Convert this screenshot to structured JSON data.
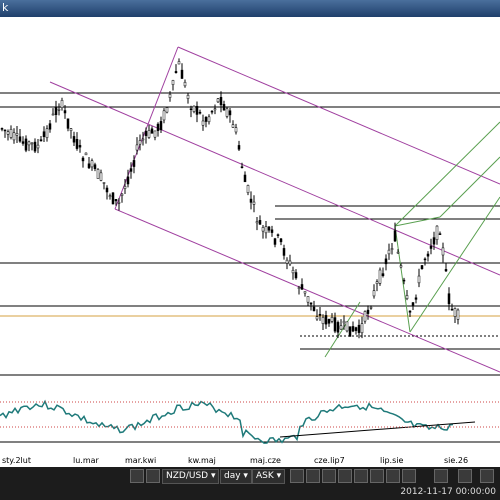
{
  "window": {
    "title": "k"
  },
  "x_axis_labels": [
    "sty.2lut",
    "lu.mar",
    "mar.kwi",
    "kw.maj",
    "maj.cze",
    "cze.lip7",
    "lip.sie",
    "sie.26"
  ],
  "toolbar": {
    "symbol": "NZD/USD",
    "period": "day",
    "price_type": "ASK"
  },
  "status": {
    "datetime": "2012-11-17 00:00:00"
  },
  "colors": {
    "channel": "#a040a0",
    "fork": "#5aa050",
    "indicator": "#1f7a7a",
    "horizontal": "#000000",
    "price_line": "#d4a040"
  }
}
